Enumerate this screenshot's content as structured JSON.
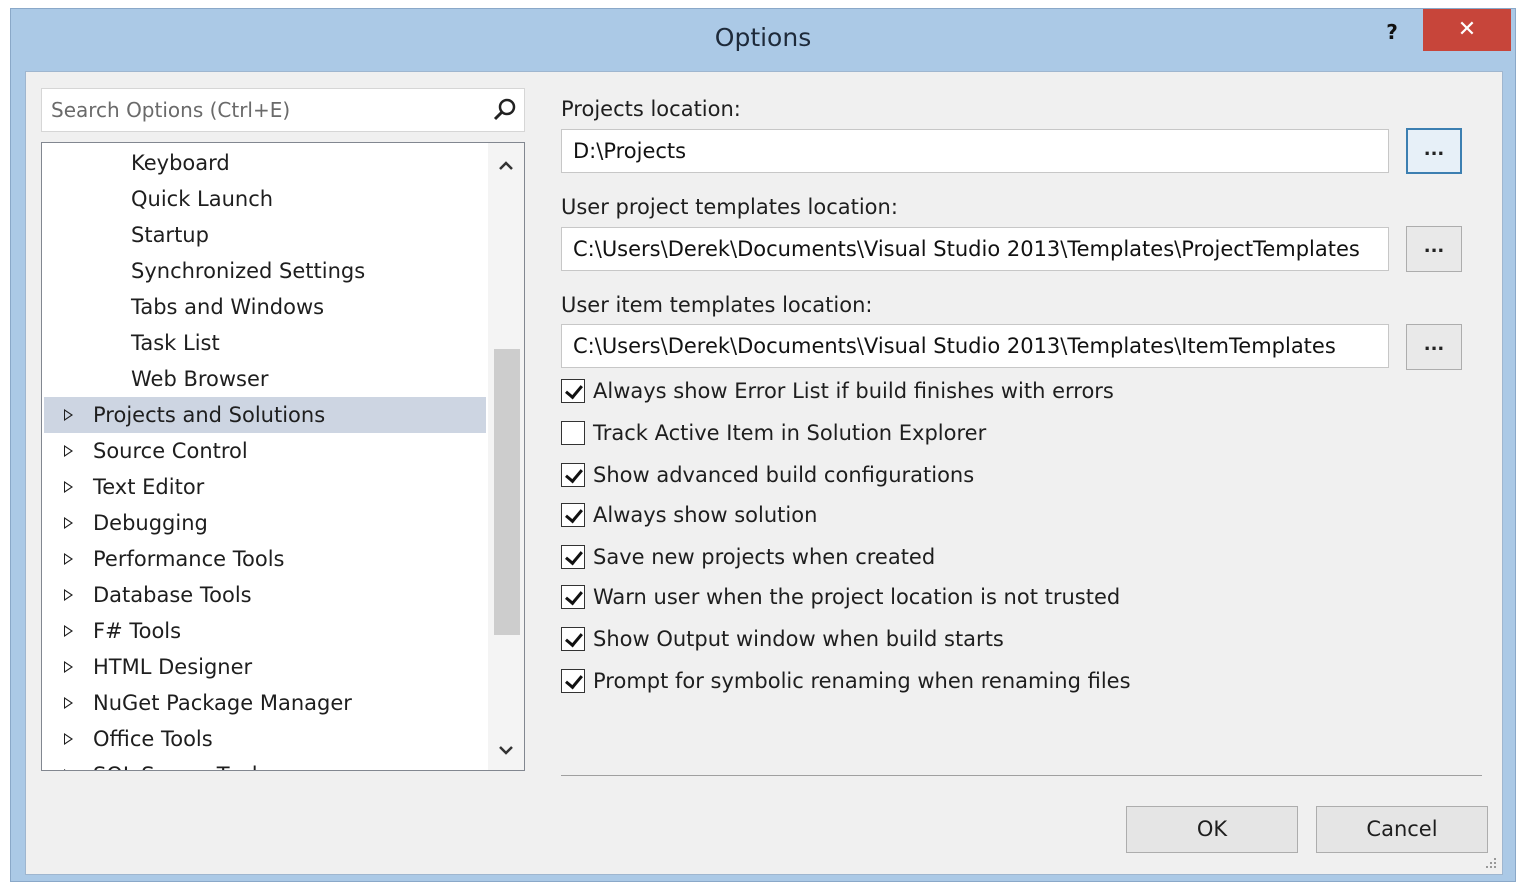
{
  "window": {
    "title": "Options",
    "help_label": "?",
    "close_label": "✕"
  },
  "search": {
    "placeholder": "Search Options (Ctrl+E)",
    "value": ""
  },
  "tree": {
    "items": [
      {
        "label": "Keyboard",
        "level": "child"
      },
      {
        "label": "Quick Launch",
        "level": "child"
      },
      {
        "label": "Startup",
        "level": "child"
      },
      {
        "label": "Synchronized Settings",
        "level": "child"
      },
      {
        "label": "Tabs and Windows",
        "level": "child"
      },
      {
        "label": "Task List",
        "level": "child"
      },
      {
        "label": "Web Browser",
        "level": "child"
      },
      {
        "label": "Projects and Solutions",
        "level": "parent",
        "selected": true
      },
      {
        "label": "Source Control",
        "level": "parent"
      },
      {
        "label": "Text Editor",
        "level": "parent"
      },
      {
        "label": "Debugging",
        "level": "parent"
      },
      {
        "label": "Performance Tools",
        "level": "parent"
      },
      {
        "label": "Database Tools",
        "level": "parent"
      },
      {
        "label": "F# Tools",
        "level": "parent"
      },
      {
        "label": "HTML Designer",
        "level": "parent"
      },
      {
        "label": "NuGet Package Manager",
        "level": "parent"
      },
      {
        "label": "Office Tools",
        "level": "parent"
      },
      {
        "label": "SQL Server Tools",
        "level": "parent"
      }
    ]
  },
  "settings": {
    "projects_location": {
      "label": "Projects location:",
      "value": "D:\\Projects",
      "browse_label": "..."
    },
    "project_templates": {
      "label": "User project templates location:",
      "value": "C:\\Users\\Derek\\Documents\\Visual Studio 2013\\Templates\\ProjectTemplates",
      "browse_label": "..."
    },
    "item_templates": {
      "label": "User item templates location:",
      "value": "C:\\Users\\Derek\\Documents\\Visual Studio 2013\\Templates\\ItemTemplates",
      "browse_label": "..."
    },
    "checkboxes": [
      {
        "label": "Always show Error List if build finishes with errors",
        "checked": true
      },
      {
        "label": "Track Active Item in Solution Explorer",
        "checked": false
      },
      {
        "label": "Show advanced build configurations",
        "checked": true
      },
      {
        "label": "Always show solution",
        "checked": true
      },
      {
        "label": "Save new projects when created",
        "checked": true
      },
      {
        "label": "Warn user when the project location is not trusted",
        "checked": true
      },
      {
        "label": "Show Output window when build starts",
        "checked": true
      },
      {
        "label": "Prompt for symbolic renaming when renaming files",
        "checked": true
      }
    ]
  },
  "buttons": {
    "ok": "OK",
    "cancel": "Cancel"
  }
}
